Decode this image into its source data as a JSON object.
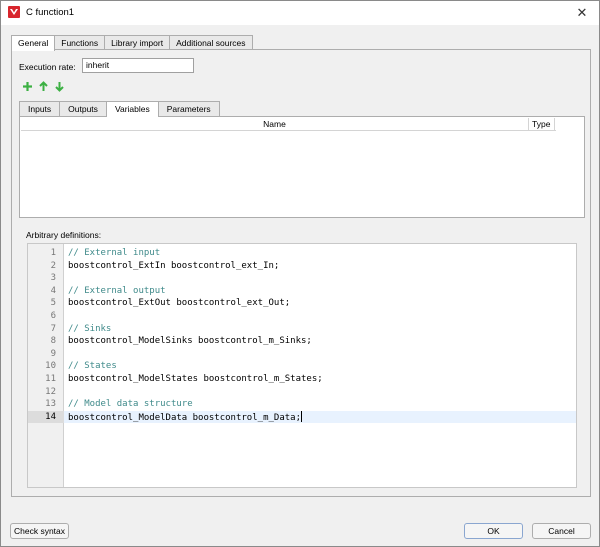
{
  "window": {
    "title": "C function1",
    "close_glyph": "✕",
    "icon": "app-logo-icon"
  },
  "outer_tabs": [
    {
      "label": "General",
      "active": true
    },
    {
      "label": "Functions",
      "active": false
    },
    {
      "label": "Library import",
      "active": false
    },
    {
      "label": "Additional sources",
      "active": false
    }
  ],
  "execution_rate": {
    "label": "Execution rate:",
    "value": "inherit"
  },
  "toolbar": {
    "add_icon": "plus-icon",
    "up_icon": "arrow-up-icon",
    "down_icon": "arrow-down-icon",
    "icon_color": "#3cb043"
  },
  "inner_tabs": [
    {
      "label": "Inputs",
      "active": false
    },
    {
      "label": "Outputs",
      "active": false
    },
    {
      "label": "Variables",
      "active": true
    },
    {
      "label": "Parameters",
      "active": false
    }
  ],
  "table": {
    "columns": [
      "Name",
      "Type"
    ],
    "rows": []
  },
  "arbitrary": {
    "label": "Arbitrary definitions:"
  },
  "editor": {
    "current_line": 14,
    "lines": [
      {
        "num": "1",
        "text": "// External input",
        "comment": true
      },
      {
        "num": "2",
        "text": "boostcontrol_ExtIn boostcontrol_ext_In;",
        "comment": false
      },
      {
        "num": "3",
        "text": "",
        "comment": false
      },
      {
        "num": "4",
        "text": "// External output",
        "comment": true
      },
      {
        "num": "5",
        "text": "boostcontrol_ExtOut boostcontrol_ext_Out;",
        "comment": false
      },
      {
        "num": "6",
        "text": "",
        "comment": false
      },
      {
        "num": "7",
        "text": "// Sinks",
        "comment": true
      },
      {
        "num": "8",
        "text": "boostcontrol_ModelSinks boostcontrol_m_Sinks;",
        "comment": false
      },
      {
        "num": "9",
        "text": "",
        "comment": false
      },
      {
        "num": "10",
        "text": "// States",
        "comment": true
      },
      {
        "num": "11",
        "text": "boostcontrol_ModelStates boostcontrol_m_States;",
        "comment": false
      },
      {
        "num": "12",
        "text": "",
        "comment": false
      },
      {
        "num": "13",
        "text": "// Model data structure",
        "comment": true
      },
      {
        "num": "14",
        "text": "boostcontrol_ModelData boostcontrol_m_Data;",
        "comment": false
      }
    ]
  },
  "buttons": {
    "check_syntax": "Check syntax",
    "ok": "OK",
    "cancel": "Cancel"
  }
}
